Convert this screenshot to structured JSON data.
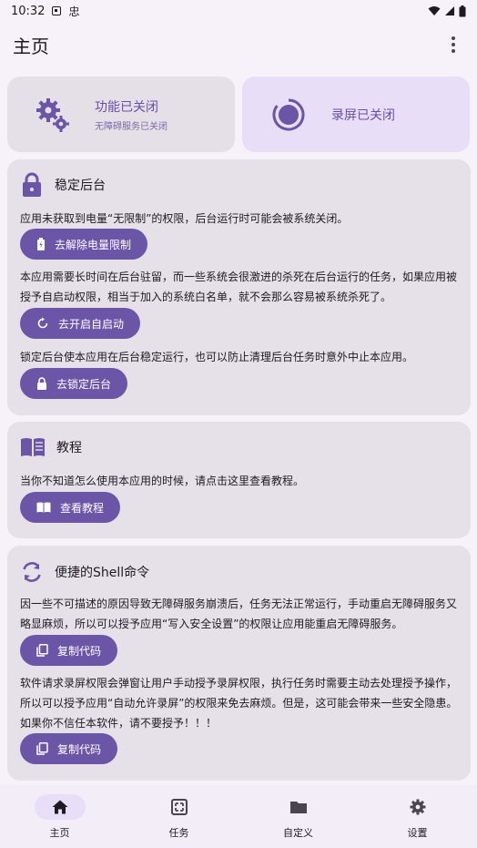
{
  "status_bar": {
    "time": "10:32",
    "glyph": "忠"
  },
  "app_bar": {
    "title": "主页"
  },
  "tiles": {
    "accessibility": {
      "title": "功能已关闭",
      "subtitle": "无障碍服务已关闭"
    },
    "recording": {
      "title": "录屏已关闭"
    }
  },
  "stable_card": {
    "title": "稳定后台",
    "p1": "应用未获取到电量“无限制”的权限，后台运行时可能会被系统关闭。",
    "btn1": "去解除电量限制",
    "p2": "本应用需要长时间在后台驻留，而一些系统会很激进的杀死在后台运行的任务，如果应用被授予自启动权限，相当于加入的系统白名单，就不会那么容易被系统杀死了。",
    "btn2": "去开启自启动",
    "p3": "锁定后台使本应用在后台稳定运行，也可以防止清理后台任务时意外中止本应用。",
    "btn3": "去锁定后台"
  },
  "tutorial_card": {
    "title": "教程",
    "p1": "当你不知道怎么使用本应用的时候，请点击这里查看教程。",
    "btn1": "查看教程"
  },
  "shell_card": {
    "title": "便捷的Shell命令",
    "p1": "因一些不可描述的原因导致无障碍服务崩溃后，任务无法正常运行，手动重启无障碍服务又略显麻烦，所以可以授予应用“写入安全设置”的权限让应用能重启无障碍服务。",
    "btn1": "复制代码",
    "p2": "软件请求录屏权限会弹窗让用户手动授予录屏权限，执行任务时需要主动去处理授予操作，所以可以授予应用“自动允许录屏”的权限来免去麻烦。但是，这可能会带来一些安全隐患。如果你不信任本软件，请不要授予！！！",
    "btn2": "复制代码"
  },
  "bottom_nav": [
    {
      "label": "主页",
      "icon": "home-icon",
      "active": true
    },
    {
      "label": "任务",
      "icon": "task-icon",
      "active": false
    },
    {
      "label": "自定义",
      "icon": "folder-icon",
      "active": false
    },
    {
      "label": "设置",
      "icon": "gear-icon",
      "active": false
    }
  ],
  "colors": {
    "accent": "#6b55a6",
    "accent_light": "#e8def8",
    "card_bg": "#e6e1e8",
    "page_bg": "#f7f2f9"
  }
}
